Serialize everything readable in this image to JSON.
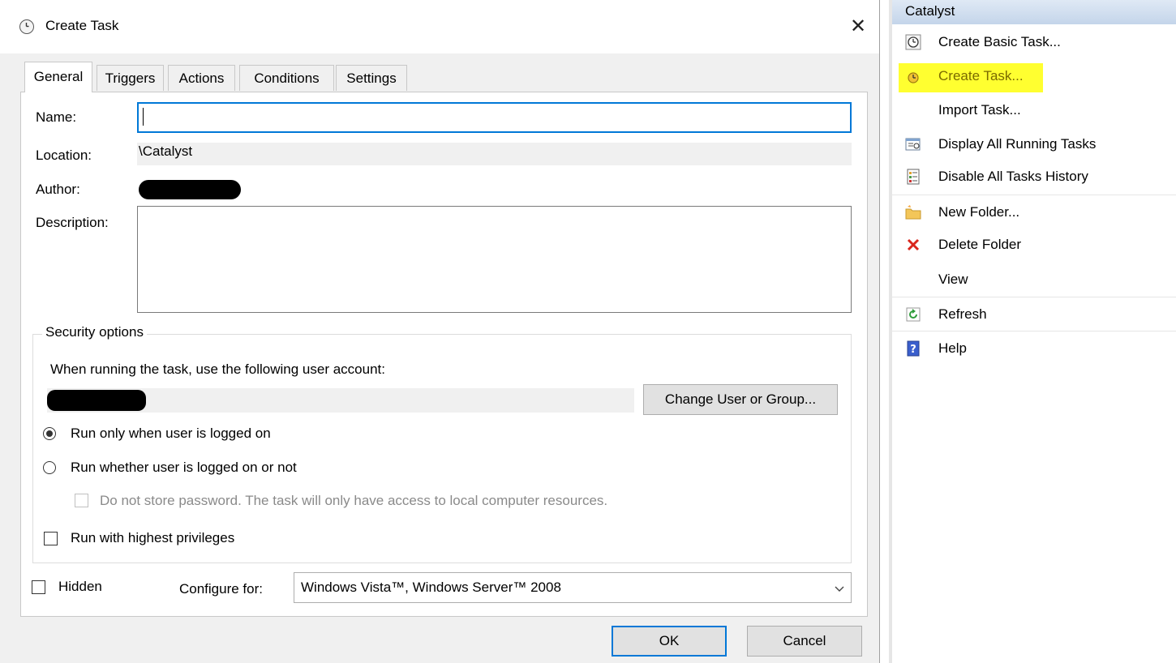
{
  "dialog": {
    "title": "Create Task",
    "close_glyph": "✕",
    "tabs": [
      "General",
      "Triggers",
      "Actions",
      "Conditions",
      "Settings"
    ],
    "active_tab": "General",
    "fields": {
      "name_label": "Name:",
      "name_value": "",
      "location_label": "Location:",
      "location_value": "\\Catalyst",
      "author_label": "Author:",
      "description_label": "Description:",
      "description_value": ""
    },
    "security": {
      "legend": "Security options",
      "account_prompt": "When running the task, use the following user account:",
      "change_button": "Change User or Group...",
      "radio_logged_on": "Run only when user is logged on",
      "radio_whether": "Run whether user is logged on or not",
      "selected_radio": "logged_on",
      "no_store_password": "Do not store password.  The task will only have access to local computer resources.",
      "highest_privileges": "Run with highest privileges"
    },
    "hidden_label": "Hidden",
    "configure_label": "Configure for:",
    "configure_value": "Windows Vista™, Windows Server™ 2008",
    "ok_button": "OK",
    "cancel_button": "Cancel"
  },
  "actions_pane": {
    "header": "Catalyst",
    "items": [
      {
        "label": "Create Basic Task...",
        "icon": "clock-icon"
      },
      {
        "label": "Create Task...",
        "icon": "task-clock-icon",
        "highlighted": true
      },
      {
        "label": "Import Task...",
        "icon": ""
      },
      {
        "label": "Display All Running Tasks",
        "icon": "running-tasks-icon"
      },
      {
        "label": "Disable All Tasks History",
        "icon": "history-icon"
      },
      {
        "label": "New Folder...",
        "icon": "folder-icon"
      },
      {
        "label": "Delete Folder",
        "icon": "delete-icon"
      },
      {
        "label": "View",
        "icon": ""
      },
      {
        "label": "Refresh",
        "icon": "refresh-icon"
      },
      {
        "label": "Help",
        "icon": "help-icon"
      }
    ]
  },
  "colors": {
    "accent": "#0078d7",
    "highlight": "#ffff30",
    "delete_red": "#d9261c"
  }
}
